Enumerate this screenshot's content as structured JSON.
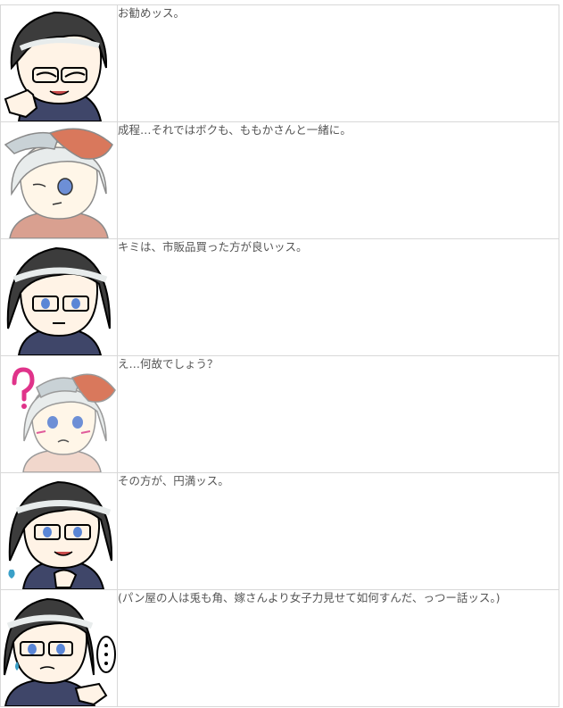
{
  "dialogue": [
    {
      "speaker": "glasses-boy",
      "expression": "pointing-smile",
      "text": "お勧めッス。"
    },
    {
      "speaker": "white-hair-girl",
      "expression": "neutral",
      "text": "成程…それではボクも、ももかさんと一緒に。"
    },
    {
      "speaker": "glasses-boy",
      "expression": "neutral",
      "text": "キミは、市販品買った方が良いッス。"
    },
    {
      "speaker": "white-hair-girl",
      "expression": "confused",
      "text": "え…何故でしょう？"
    },
    {
      "speaker": "glasses-boy",
      "expression": "sweat",
      "text": "その方が、円満ッス。"
    },
    {
      "speaker": "glasses-boy",
      "expression": "thinking",
      "text": "(パン屋の人は兎も角、嫁さんより女子力見せて如何すんだ、っつー話ッス。)"
    }
  ],
  "colors": {
    "border": "#d8d8d8",
    "text": "#555555",
    "question_mark": "#e0338a",
    "hair_dark": "#3c3c3c",
    "hair_white": "#e8ecec",
    "shirt": "#3f4669",
    "hat": "#d9785c"
  }
}
